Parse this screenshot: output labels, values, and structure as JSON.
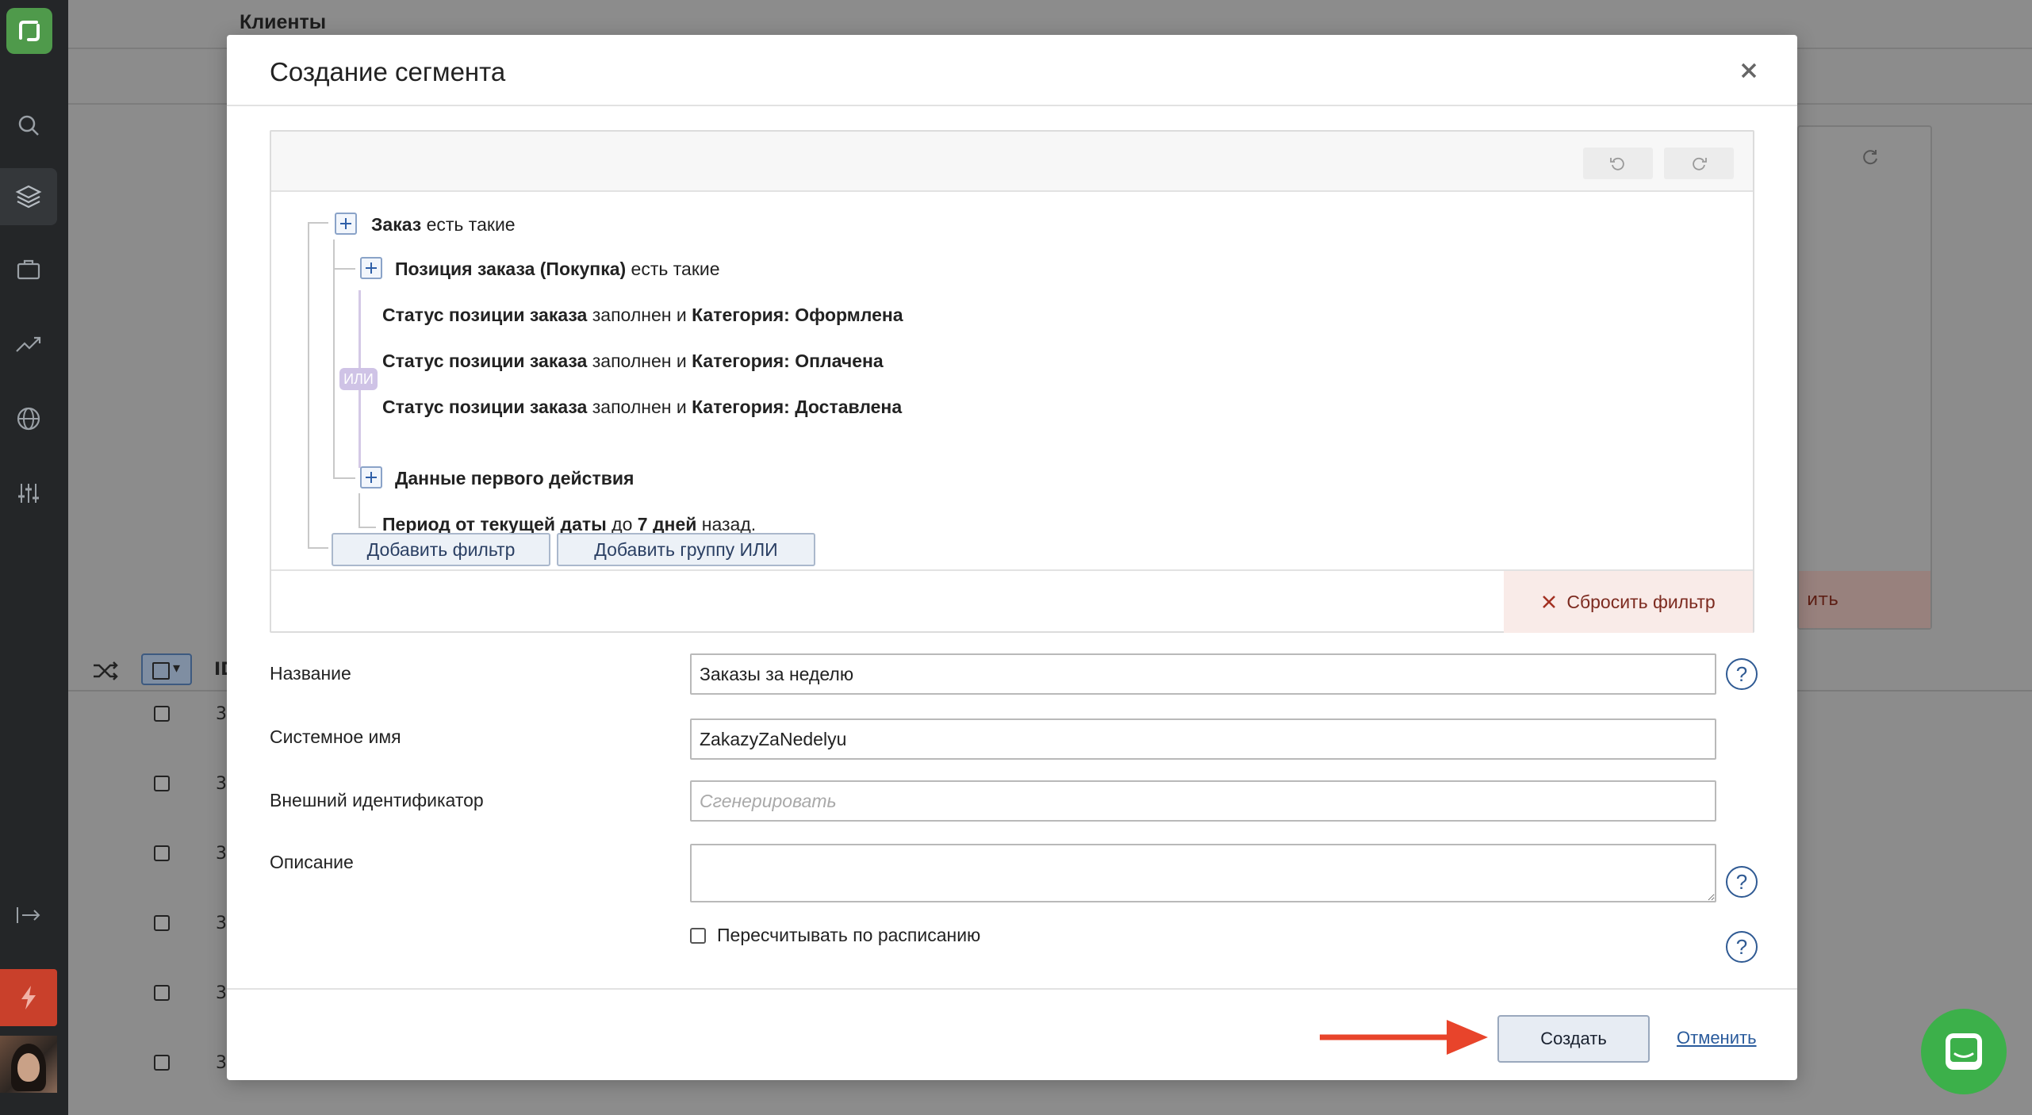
{
  "background": {
    "page_title": "Клиенты",
    "id_header": "ID",
    "row_id_prefix": [
      "3",
      "3",
      "3",
      "3",
      "3",
      "3"
    ],
    "reset_fragment": "ить"
  },
  "modal": {
    "title": "Создание сегмента",
    "close_label": "×",
    "filter_tree": {
      "order": {
        "name": "Заказ",
        "suffix": "есть такие"
      },
      "order_item": {
        "name": "Позиция заказа (Покупка)",
        "suffix": "есть такие"
      },
      "conditions": [
        {
          "field": "Статус позиции заказа",
          "op": "заполнен и",
          "cat_label": "Категория:",
          "value": "Оформлена"
        },
        {
          "field": "Статус позиции заказа",
          "op": "заполнен и",
          "cat_label": "Категория:",
          "value": "Оплачена"
        },
        {
          "field": "Статус позиции заказа",
          "op": "заполнен и",
          "cat_label": "Категория:",
          "value": "Доставлена"
        }
      ],
      "or_badge": "ИЛИ",
      "first_action": {
        "name": "Данные первого действия"
      },
      "period": {
        "field": "Период от текущей даты",
        "mid": "до",
        "value": "7 дней",
        "tail": "назад."
      },
      "add_filter_label": "Добавить фильтр",
      "add_or_group_label": "Добавить группу ИЛИ",
      "reset_label": "Сбросить фильтр"
    },
    "form": {
      "name_label": "Название",
      "name_value": "Заказы за неделю",
      "system_name_label": "Системное имя",
      "system_name_value": "ZakazyZaNedelyu",
      "external_id_label": "Внешний идентификатор",
      "external_id_placeholder": "Сгенерировать",
      "description_label": "Описание",
      "description_value": "",
      "recalc_label": "Пересчитывать по расписанию",
      "help_glyph": "?"
    },
    "footer": {
      "create_label": "Создать",
      "cancel_label": "Отменить"
    }
  },
  "colors": {
    "brand_green": "#4f9a4b",
    "chat_green": "#3cb04a",
    "arrow_red": "#e8442b",
    "link_blue": "#2a5b9c"
  }
}
